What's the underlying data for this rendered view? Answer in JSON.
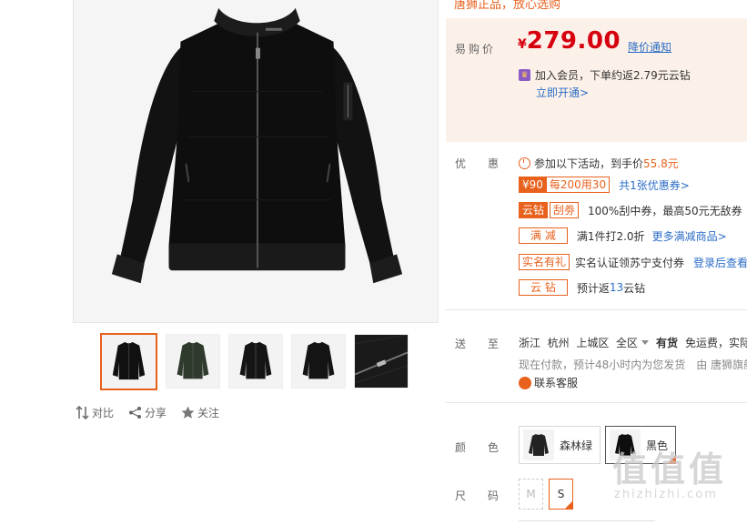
{
  "slogan": "唐狮正品，放心选购",
  "price": {
    "label": "易购价",
    "currency": "¥",
    "value": "279.00",
    "drop_notify": "降价通知",
    "member_text": "加入会员，下单约返2.79元云钻",
    "open_link": "立即开通>"
  },
  "promo": {
    "label": "优惠",
    "activity_text": "参加以下活动，到手价",
    "activity_price": "55.8元",
    "coupon_amount": "¥90",
    "coupon_rule": "每200用30",
    "coupon_count": "共1张优惠券>",
    "yunzuan_tag": "云钻",
    "guaquan_tag": "刮劵",
    "yunzuan_text": "100%刮中券，最高50元无敌券",
    "manjian_tag": "满 减",
    "manjian_text": "满1件打2.0折",
    "manjian_link": "更多满减商品>",
    "shiming_tag": "实名有礼",
    "shiming_text": "实名认证领苏宁支付券",
    "shiming_link": "登录后查看",
    "yunzuan2_tag": "云 钻",
    "yunzuan2_prefix": "预计返",
    "yunzuan2_value": "13",
    "yunzuan2_suffix": "云钻"
  },
  "delivery": {
    "label": "送至",
    "province": "浙江",
    "city": "杭州",
    "district": "上城区",
    "area": "全区",
    "stock": "有货",
    "freight": "免运费，实际",
    "note": "现在付款，预计48小时内为您发货",
    "shipper": "由 唐狮旗舰",
    "service": "联系客服"
  },
  "color": {
    "label": "颜色",
    "options": [
      "森林绿",
      "黑色"
    ]
  },
  "size": {
    "label": "尺码",
    "options": [
      "M",
      "S"
    ]
  },
  "tools": {
    "compare": "对比",
    "share": "分享",
    "follow": "关注"
  },
  "watermark": {
    "big": "值值值",
    "small": "zhizhizhi.com"
  },
  "colors": {
    "accent": "#e8611d",
    "price": "#d6000f",
    "link": "#2c6dc7",
    "price_bg": "#fcf1e8"
  }
}
